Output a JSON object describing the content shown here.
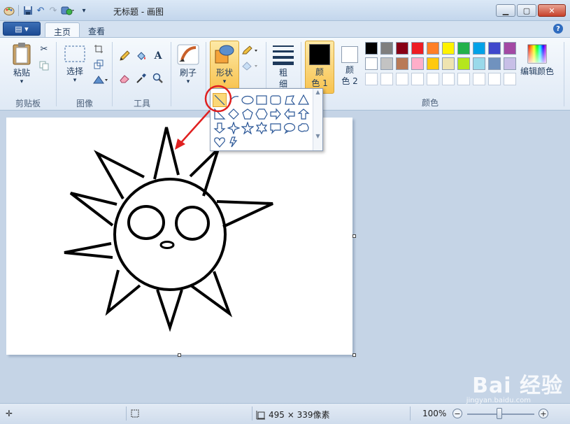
{
  "window": {
    "title": "无标题 - 画图",
    "minimize": "▁",
    "maximize": "▢",
    "close": "✕"
  },
  "qat": {
    "icons": [
      "paint-app-icon",
      "save-icon",
      "undo-icon",
      "redo-icon",
      "customize-icon"
    ]
  },
  "tabs": [
    {
      "label": "主页",
      "active": true
    },
    {
      "label": "查看",
      "active": false
    }
  ],
  "app_menu": {
    "label": "▤ ▾"
  },
  "ribbon": {
    "clipboard": {
      "group_label": "剪贴板",
      "paste_label": "粘贴"
    },
    "image": {
      "group_label": "图像",
      "select_label": "选择"
    },
    "tools": {
      "group_label": "工具"
    },
    "brushes": {
      "label": "刷子"
    },
    "shapes": {
      "label": "形状"
    },
    "size": {
      "label_line1": "粗",
      "label_line2": "细"
    },
    "color1": {
      "label_line1": "颜",
      "label_line2": "色 1",
      "value": "#000000"
    },
    "color2": {
      "label_line1": "颜",
      "label_line2": "色 2",
      "value": "#ffffff"
    },
    "colors": {
      "group_label": "颜色",
      "edit_label": "编辑颜色",
      "row1": [
        "#000000",
        "#7f7f7f",
        "#880015",
        "#ed1c24",
        "#ff7f27",
        "#fff200",
        "#22b14c",
        "#00a2e8",
        "#3f48cc",
        "#a349a4"
      ],
      "row2": [
        "#ffffff",
        "#c3c3c3",
        "#b97a57",
        "#ffaec9",
        "#ffc90e",
        "#efe4b0",
        "#b5e61d",
        "#99d9ea",
        "#7092be",
        "#c8bfe7"
      ]
    }
  },
  "status": {
    "canvas_size": "495 × 339像素",
    "zoom": "100%",
    "zoom_level": 100
  },
  "watermark": {
    "text": "Bai 经验",
    "sub": "jingyan.baidu.com"
  }
}
